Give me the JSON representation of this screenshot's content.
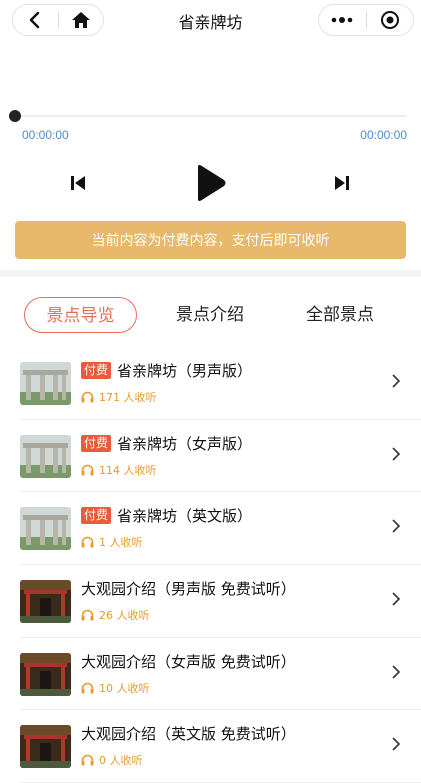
{
  "nav": {
    "title": "省亲牌坊"
  },
  "player": {
    "time_current": "00:00:00",
    "time_total": "00:00:00",
    "pay_notice": "当前内容为付费内容，支付后即可收听"
  },
  "tabs": [
    "景点导览",
    "景点介绍",
    "全部景点"
  ],
  "items": [
    {
      "badge": "付费",
      "title": "省亲牌坊（男声版）",
      "listeners": "171 人收听",
      "thumb": "arch"
    },
    {
      "badge": "付费",
      "title": "省亲牌坊（女声版）",
      "listeners": "114 人收听",
      "thumb": "arch"
    },
    {
      "badge": "付费",
      "title": "省亲牌坊（英文版）",
      "listeners": "1 人收听",
      "thumb": "arch"
    },
    {
      "badge": "",
      "title": "大观园介绍（男声版 免费试听）",
      "listeners": "26 人收听",
      "thumb": "garden"
    },
    {
      "badge": "",
      "title": "大观园介绍（女声版 免费试听）",
      "listeners": "10 人收听",
      "thumb": "garden"
    },
    {
      "badge": "",
      "title": "大观园介绍（英文版 免费试听）",
      "listeners": "0 人收听",
      "thumb": "garden"
    }
  ],
  "colors": {
    "accent": "#e86b55",
    "gold": "#e8b96a",
    "time": "#4a8ed1",
    "badge": "#ea5b3c",
    "listen": "#e89a2a"
  },
  "icons": [
    "back-icon",
    "home-icon",
    "more-icon",
    "target-icon",
    "prev-icon",
    "play-icon",
    "next-icon",
    "headphone-icon",
    "chevron-right-icon"
  ]
}
